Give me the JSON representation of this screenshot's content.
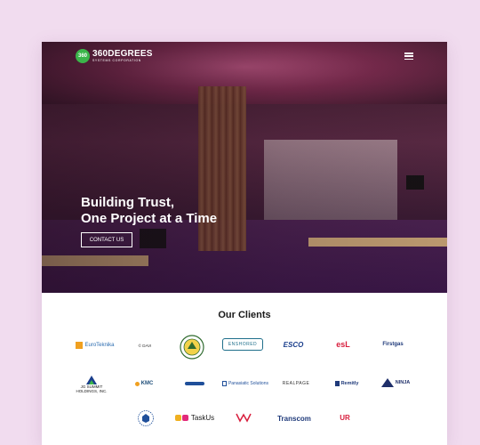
{
  "header": {
    "logo_badge": "360",
    "logo_main": "360DEGREES",
    "logo_sub": "SYSTEMS CORPORATION",
    "menu_icon": "hamburger-icon"
  },
  "hero": {
    "headline_line1": "Building Trust,",
    "headline_line2": "One Project at a Time",
    "cta_label": "CONTACT US"
  },
  "clients": {
    "title": "Our Clients",
    "logos": [
      {
        "name": "euroteknika",
        "text": "EuroTeknika",
        "color": "#2b6cb0"
      },
      {
        "name": "davi",
        "text": "© DAVI",
        "color": "#333333"
      },
      {
        "name": "seal",
        "text": "",
        "color": "#2f6b2f"
      },
      {
        "name": "enshored",
        "text": "ENSHORED",
        "color": "#1f6f8b"
      },
      {
        "name": "esco",
        "text": "ESCO",
        "color": "#1a3e8c"
      },
      {
        "name": "esl",
        "text": "esL",
        "color": "#d81e3d"
      },
      {
        "name": "firstgas",
        "text": "Firstgas",
        "color": "#1f3a7a"
      },
      {
        "name": "jg-summit",
        "text": "JG SUMMIT HOLDINGS, INC.",
        "color": "#1a1a1a"
      },
      {
        "name": "kmc",
        "text": "KMC",
        "color": "#1f4f7a"
      },
      {
        "name": "small-logo",
        "text": "",
        "color": "#1f4f9a"
      },
      {
        "name": "panasiatic",
        "text": "Panasiatic Solutions",
        "color": "#1f4f9a"
      },
      {
        "name": "realpage",
        "text": "REALPAGE",
        "color": "#333333"
      },
      {
        "name": "remitly",
        "text": "Remitly",
        "color": "#1f3a7a"
      },
      {
        "name": "shipping-ninja",
        "text": "NINJA",
        "color": "#1f2f6a"
      },
      {
        "name": "badge",
        "text": "",
        "color": "#1f4f9a"
      },
      {
        "name": "taskus",
        "text": "TaskUs",
        "color": "#1a1a1a"
      },
      {
        "name": "w-logo",
        "text": "",
        "color": "#d81e3d"
      },
      {
        "name": "transcom",
        "text": "Transcom",
        "color": "#1f3a7a"
      },
      {
        "name": "ur",
        "text": "UR",
        "color": "#d81e3d"
      }
    ]
  }
}
